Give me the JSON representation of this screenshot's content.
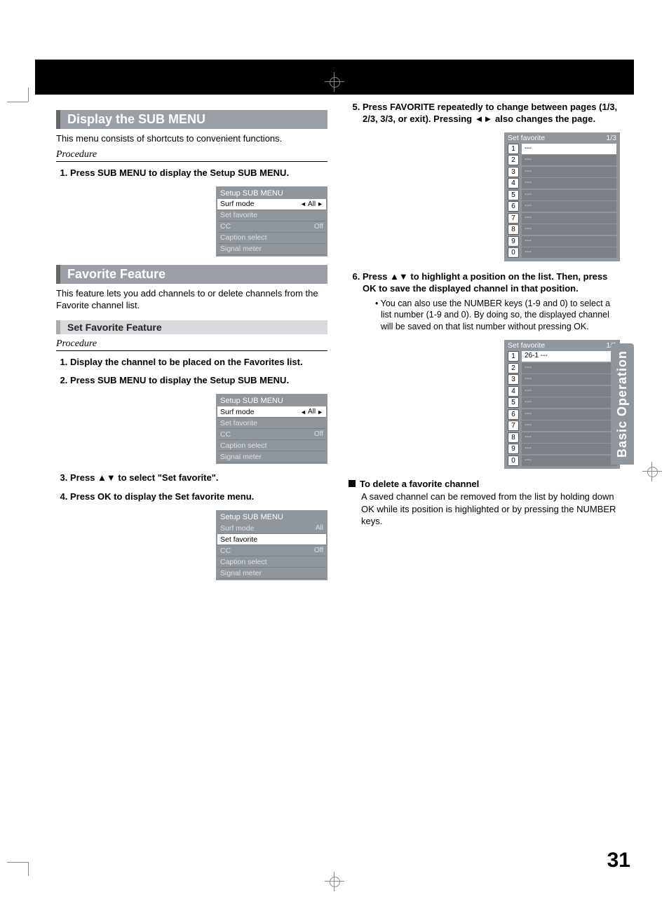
{
  "left": {
    "section1": {
      "title": "Display the SUB MENU",
      "intro": "This menu consists of shortcuts to convenient functions.",
      "procedure_label": "Procedure",
      "step1": "Press SUB MENU to display the Setup SUB MENU."
    },
    "section2": {
      "title": "Favorite Feature",
      "intro": "This feature lets you add channels to or delete channels from the Favorite channel list.",
      "subhead": "Set Favorite Feature",
      "procedure_label": "Procedure",
      "step1": "Display the channel to be placed on the Favorites list.",
      "step2": "Press SUB MENU to display the Setup SUB MENU.",
      "step3": "Press ▲▼ to select \"Set favorite\".",
      "step4": "Press OK to display the Set favorite menu."
    }
  },
  "right": {
    "step5": "Press FAVORITE repeatedly to change between pages (1/3, 2/3, 3/3, or exit). Pressing ◄► also changes the page.",
    "step6": "Press ▲▼ to highlight a position on the list. Then, press OK to save the displayed channel in that position.",
    "step6_note": "You can also use the NUMBER keys (1-9 and 0) to select a list number (1-9 and 0). By doing so, the displayed channel will be saved on that list number without pressing OK.",
    "delete_head": "To delete a favorite channel",
    "delete_body": "A saved channel can be removed from the list by holding down OK while its position is highlighted or by pressing the NUMBER keys."
  },
  "menus": {
    "setup": {
      "title": "Setup SUB MENU",
      "rows": [
        {
          "label": "Surf mode",
          "value": "All"
        },
        {
          "label": "Set favorite",
          "value": ""
        },
        {
          "label": "CC",
          "value": "Off"
        },
        {
          "label": "Caption select",
          "value": ""
        },
        {
          "label": "Signal meter",
          "value": ""
        }
      ]
    },
    "favorite": {
      "title": "Set favorite",
      "page": "1/3",
      "nums": [
        "1",
        "2",
        "3",
        "4",
        "5",
        "6",
        "7",
        "8",
        "9",
        "0"
      ],
      "empty": "---",
      "row1_saved": "26-1    ---"
    }
  },
  "side_tab": "Basic Operation",
  "page_number": "31"
}
